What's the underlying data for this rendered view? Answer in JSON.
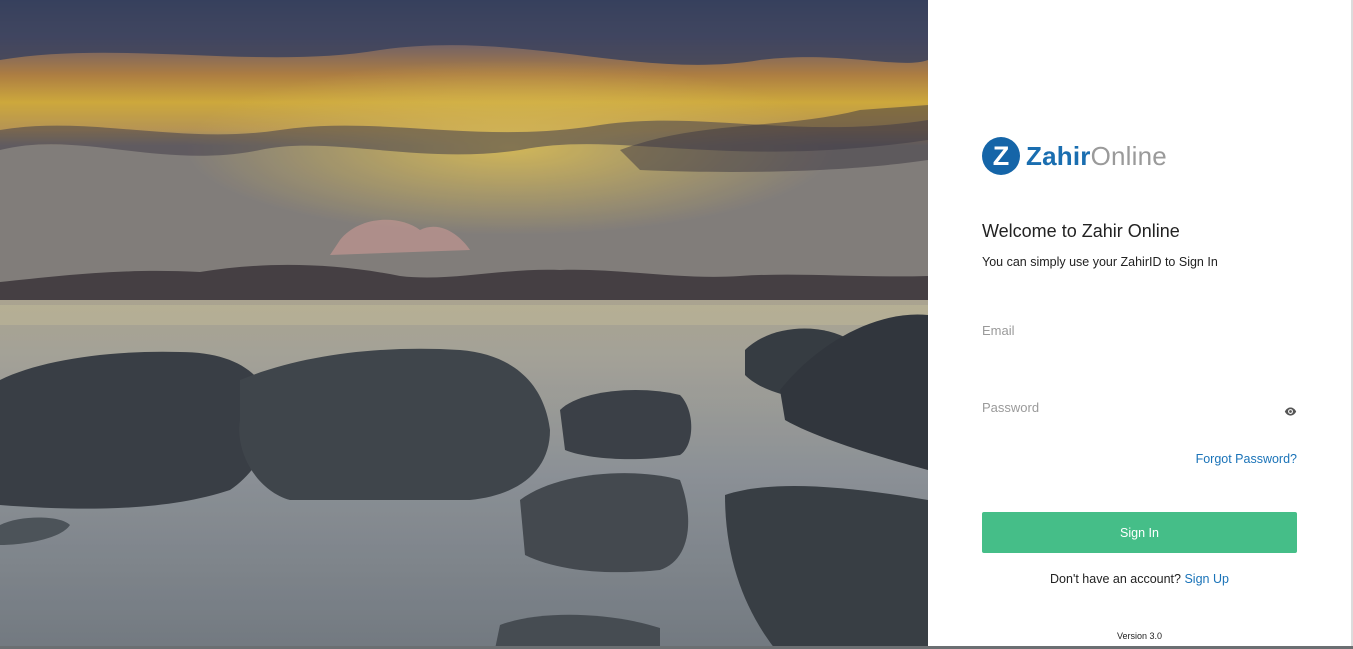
{
  "brand": {
    "logo_mark": "Z",
    "name_primary": "Zahir",
    "name_secondary": "Online",
    "primary_color": "#1565a8",
    "accent_color": "#45be88",
    "link_color": "#1a73b8"
  },
  "hero": {
    "image": "sunset-coastal-rocks-photo"
  },
  "login": {
    "title": "Welcome to Zahir Online",
    "subtitle": "You can simply use your ZahirID to Sign In",
    "email_placeholder": "Email",
    "email_value": "",
    "password_placeholder": "Password",
    "password_value": "",
    "password_toggle_icon": "eye-icon",
    "forgot_label": "Forgot Password?",
    "signin_label": "Sign In",
    "no_account_text": "Don't have an account?",
    "signup_label": "Sign Up"
  },
  "footer": {
    "version": "Version 3.0"
  }
}
